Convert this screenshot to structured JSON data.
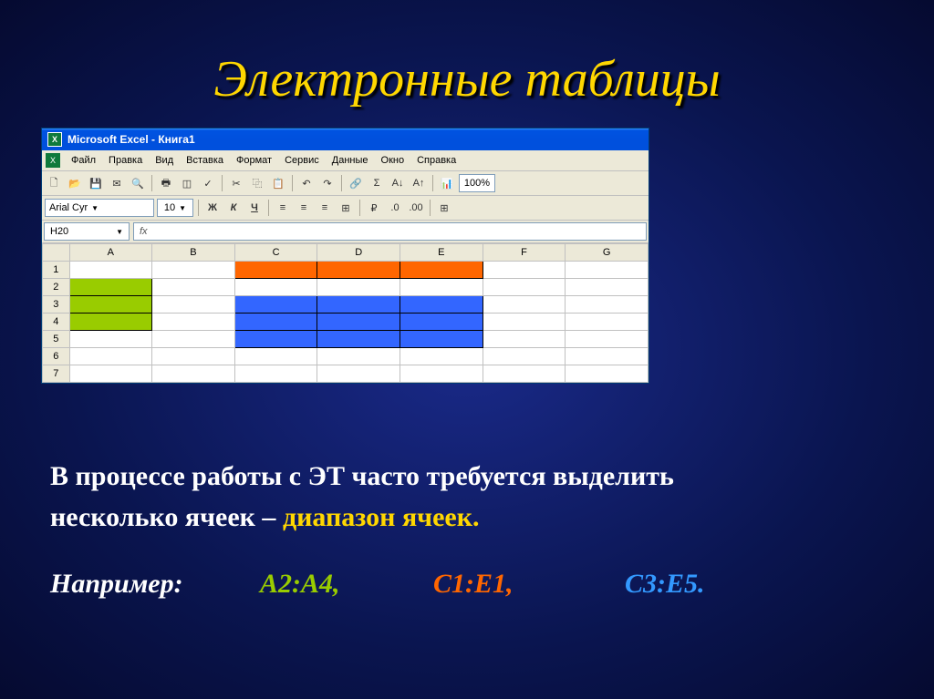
{
  "slide": {
    "title": "Электронные таблицы"
  },
  "excel": {
    "window_title": "Microsoft Excel - Книга1",
    "menu": [
      "Файл",
      "Правка",
      "Вид",
      "Вставка",
      "Формат",
      "Сервис",
      "Данные",
      "Окно",
      "Справка"
    ],
    "font_name": "Arial Cyr",
    "font_size": "10",
    "zoom": "100%",
    "name_box": "H20",
    "fx_label": "fx",
    "columns": [
      "A",
      "B",
      "C",
      "D",
      "E",
      "F",
      "G"
    ],
    "rows": [
      "1",
      "2",
      "3",
      "4",
      "5",
      "6",
      "7"
    ]
  },
  "text": {
    "line1a": "В процессе работы с ЭТ часто требуется выделить",
    "line2a": "несколько ячеек – ",
    "keyword": "диапазон ячеек.",
    "example_label": "Например:",
    "range_green": "А2:А4,",
    "range_orange": "С1:Е1,",
    "range_blue": "С3:Е5."
  },
  "chart_data": {
    "type": "table",
    "description": "Excel grid with colored cell ranges illustrating selections",
    "ranges": [
      {
        "name": "A2:A4",
        "cells": [
          "A2",
          "A3",
          "A4"
        ],
        "color": "#99cc00"
      },
      {
        "name": "C1:E1",
        "cells": [
          "C1",
          "D1",
          "E1"
        ],
        "color": "#ff6600"
      },
      {
        "name": "C3:E5",
        "cells": [
          "C3",
          "D3",
          "E3",
          "C4",
          "D4",
          "E4",
          "C5",
          "D5",
          "E5"
        ],
        "color": "#3366ff"
      }
    ]
  }
}
